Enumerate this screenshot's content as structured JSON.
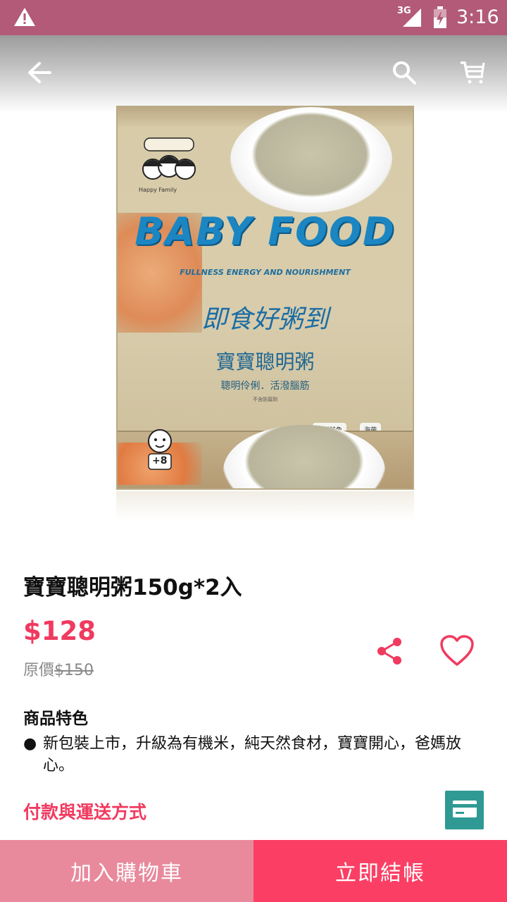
{
  "status_bar": {
    "time": "3:16",
    "network": "3G",
    "icons": [
      "warning-icon",
      "cell-signal-icon",
      "battery-icon"
    ]
  },
  "toolbar": {
    "icons": [
      "back-arrow-icon",
      "search-icon",
      "cart-icon"
    ]
  },
  "product_image": {
    "brand_logo_text": "Happy Family",
    "headline": "BABY FOOD",
    "tagline": "FULLNESS ENERGY AND NOURISHMENT",
    "cn_title": "即食好粥到",
    "cn_product": "寶寶聰明粥",
    "cn_slogan": "聰明伶俐．活潑腦筋",
    "cn_note": "不含防腐劑",
    "badges": [
      "新鮮鮭魚",
      "海帶"
    ],
    "age_badge": "+8"
  },
  "product": {
    "title": "寶寶聰明粥150g*2入",
    "price": "$128",
    "original_price_label": "原價",
    "original_price_value": "$150",
    "features_title": "商品特色",
    "features": [
      "新包裝上市，升級為有機米，純天然食材，寶寶開心，爸媽放心。"
    ],
    "payment_link": "付款與運送方式"
  },
  "actions": {
    "add_to_cart": "加入購物車",
    "checkout": "立即結帳"
  },
  "colors": {
    "status_bar": "#b25a78",
    "price": "#f03a5f",
    "add_to_cart_bg": "#e8899c",
    "checkout_bg": "#fb3f64",
    "card_button_bg": "#2f9a94"
  }
}
